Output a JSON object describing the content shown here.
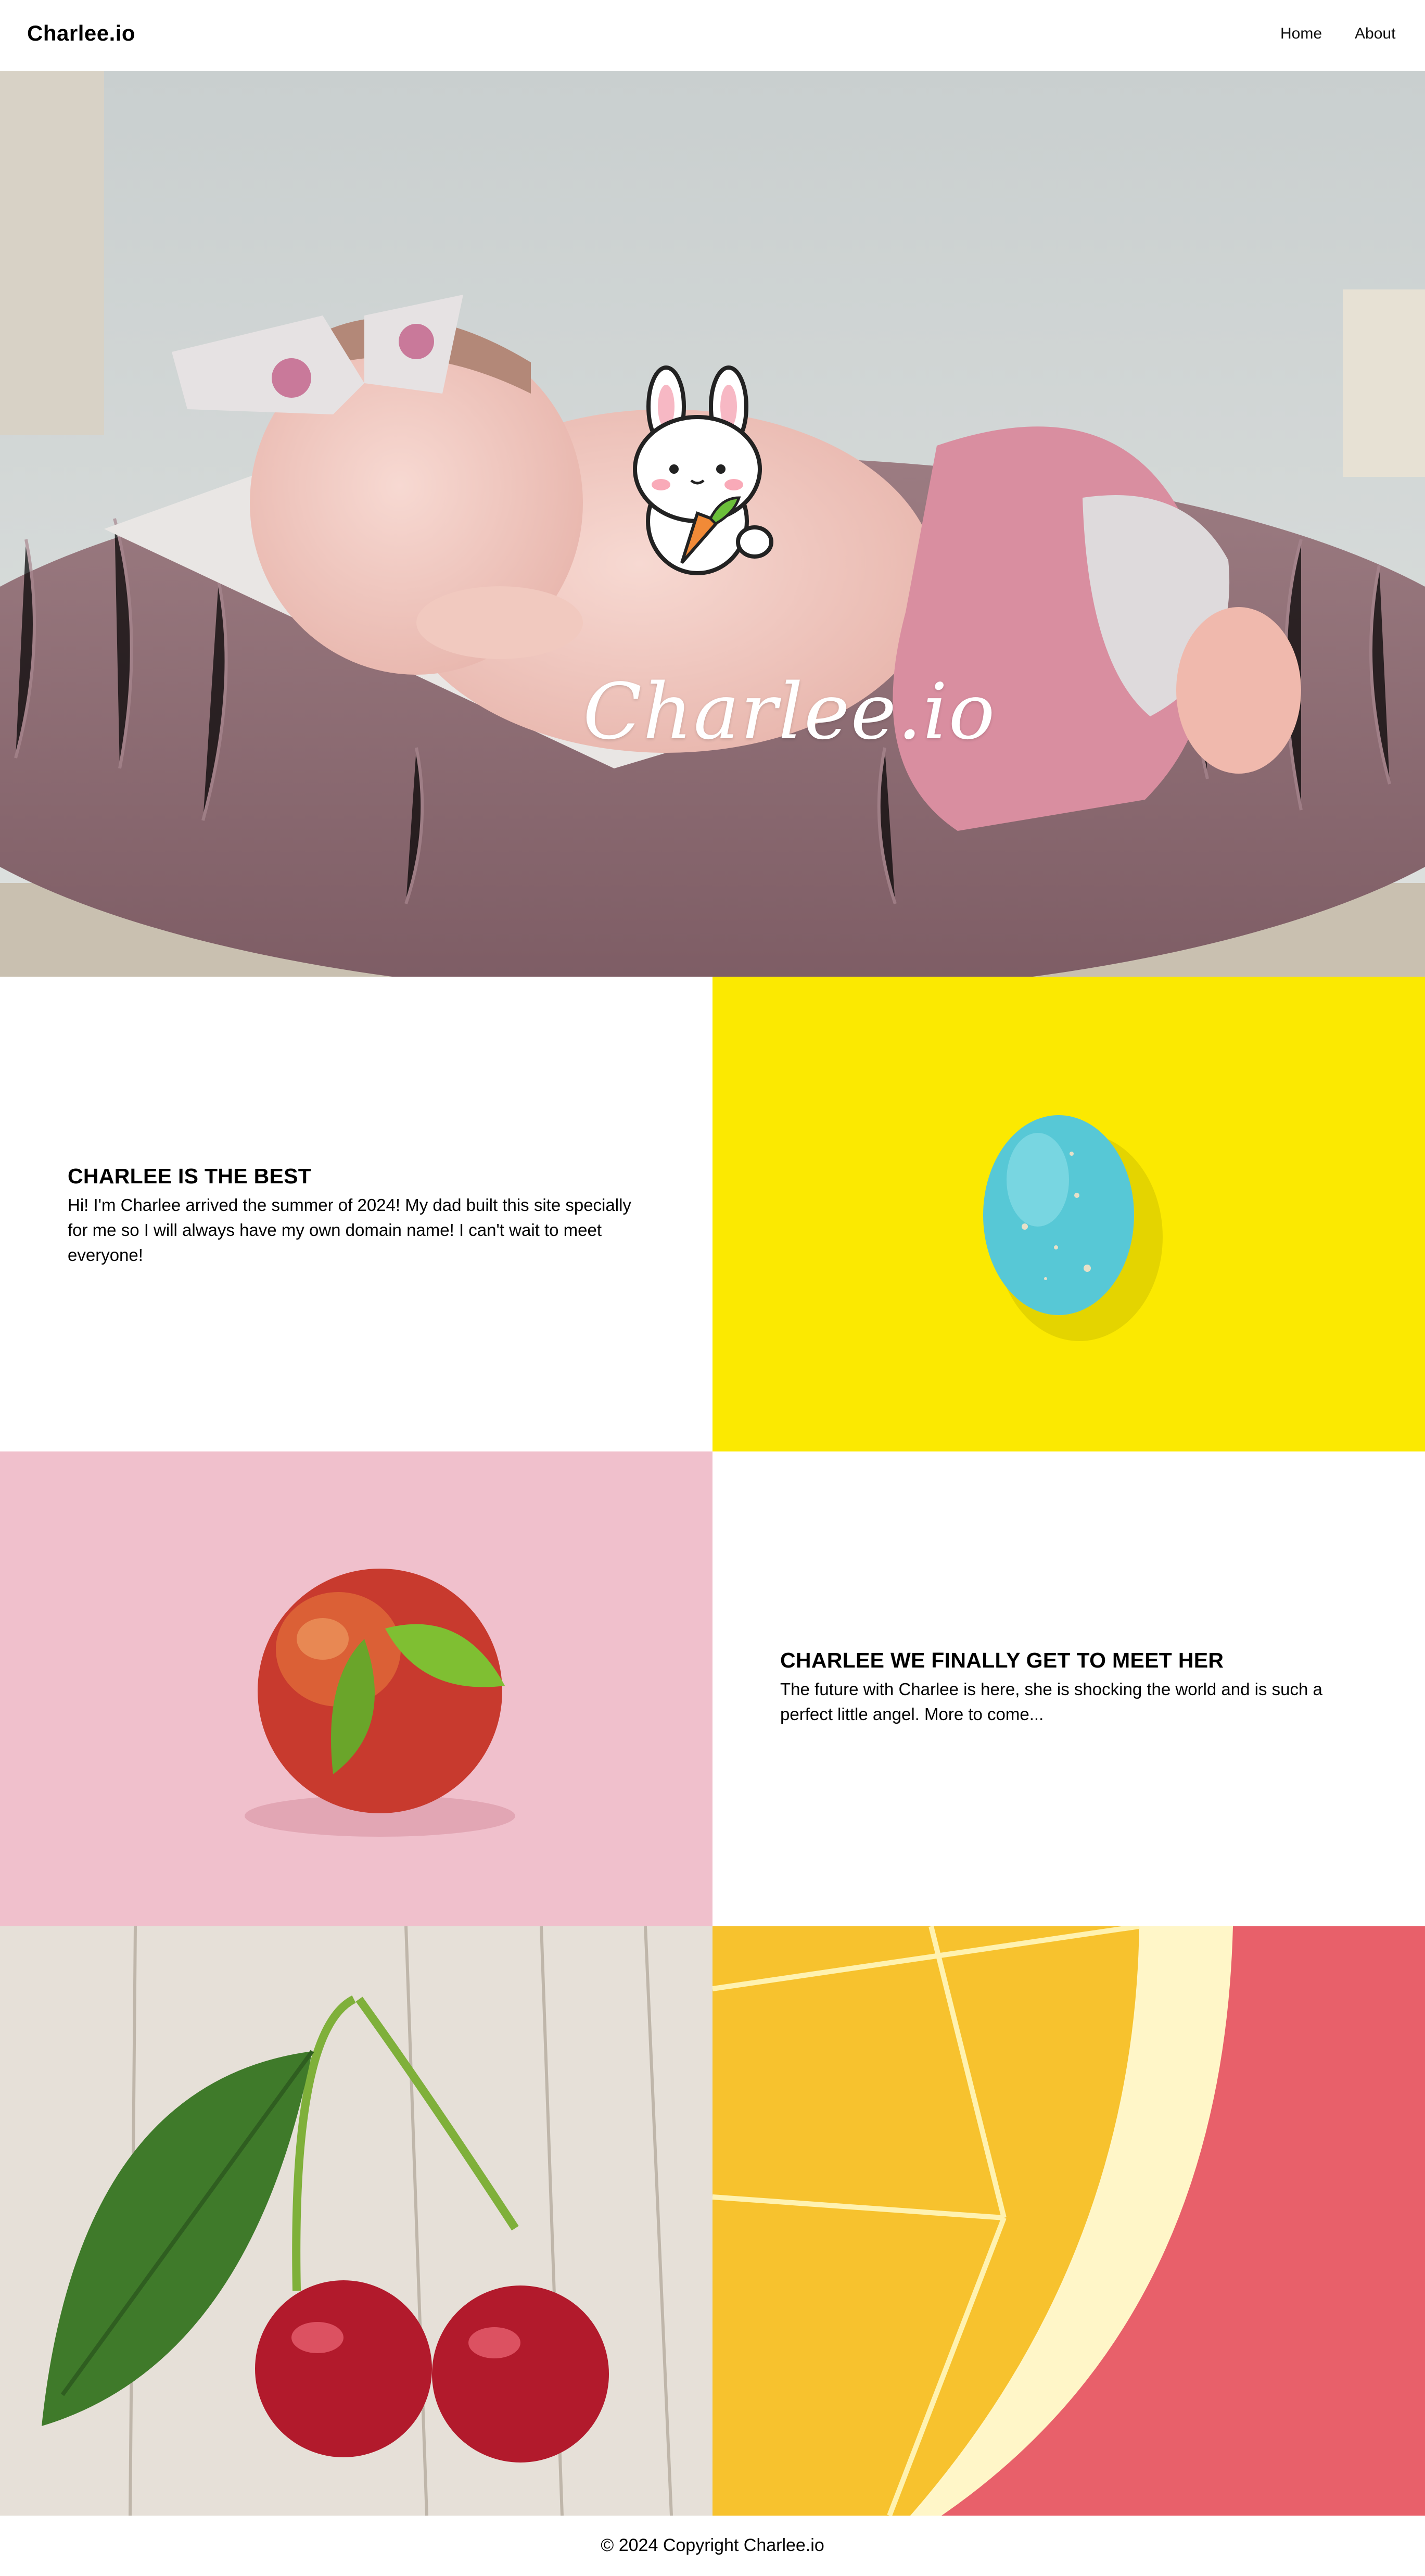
{
  "nav": {
    "brand": "Charlee.io",
    "links": [
      {
        "label": "Home"
      },
      {
        "label": "About"
      }
    ]
  },
  "hero": {
    "title": "Charlee.io",
    "image": "sleeping-baby-photo",
    "logo_icon": "bunny-with-carrot-icon"
  },
  "sections": [
    {
      "heading": "CHARLEE IS THE BEST",
      "body": "Hi! I'm Charlee arrived the summer of 2024! My dad built this site specially for me so I will always have my own domain name! I can't wait to meet everyone!"
    },
    {
      "heading": "CHARLEE WE FINALLY GET TO MEET HER",
      "body": "The future with Charlee is here, she is shocking the world and is such a perfect little angel. More to come..."
    }
  ],
  "gallery": {
    "egg": {
      "image": "blue-egg-on-yellow",
      "background": "#fbe901"
    },
    "peach": {
      "image": "peach-on-pink",
      "background": "#f0c0cc"
    },
    "cherry": {
      "image": "cherries-on-wood",
      "background": "#e6e0d8"
    },
    "orange": {
      "image": "orange-slice-on-red",
      "background": "#e8606a"
    }
  },
  "footer": {
    "text": "© 2024 Copyright Charlee.io"
  }
}
